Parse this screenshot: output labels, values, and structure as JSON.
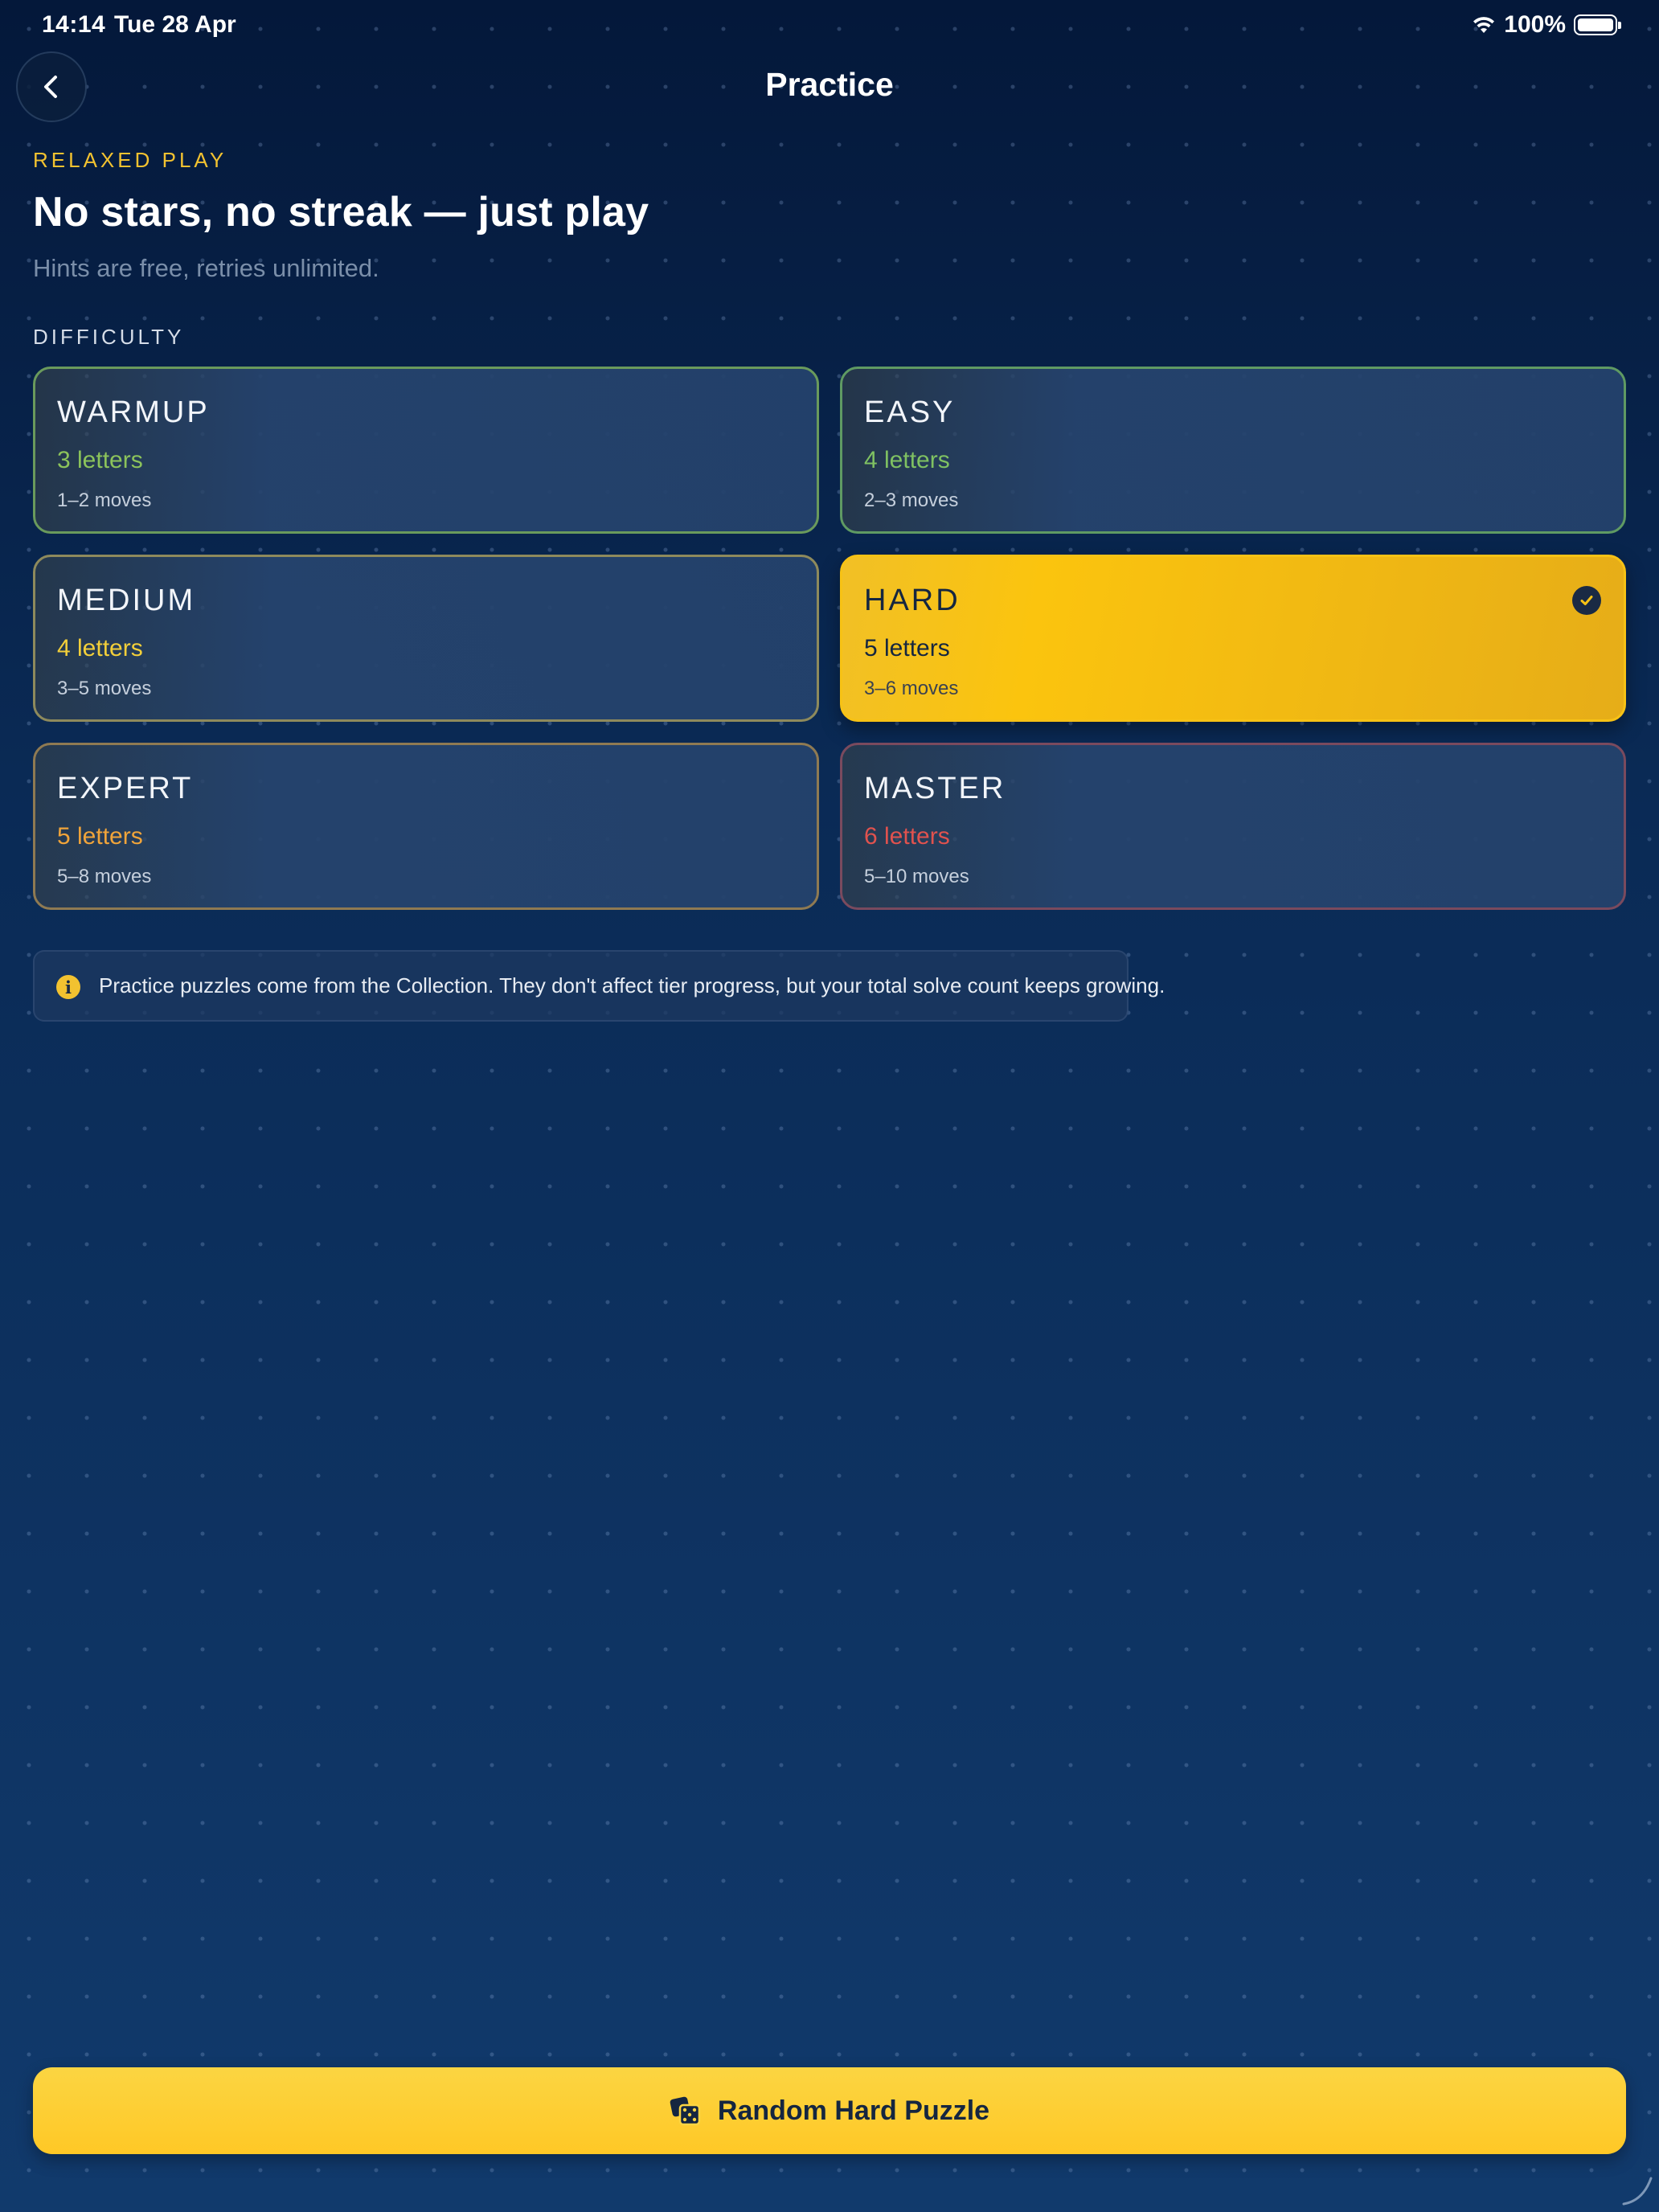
{
  "status_bar": {
    "time": "14:14",
    "date": "Tue 28 Apr",
    "battery": "100%",
    "icons": [
      "wifi-icon",
      "battery-icon"
    ]
  },
  "nav": {
    "title": "Practice",
    "back_icon": "chevron-left-icon"
  },
  "header": {
    "eyebrow": "RELAXED PLAY",
    "headline": "No stars, no streak — just play",
    "subtitle": "Hints are free, retries unlimited."
  },
  "section_label": "DIFFICULTY",
  "difficulties": [
    {
      "level": "WARMUP",
      "letters": "3 letters",
      "moves": "1–2 moves",
      "accent": "#6a9a5c",
      "letters_color": "#8cc35b",
      "selected": false
    },
    {
      "level": "EASY",
      "letters": "4 letters",
      "moves": "2–3 moves",
      "accent": "#5f9a63",
      "letters_color": "#7fc162",
      "selected": false
    },
    {
      "level": "MEDIUM",
      "letters": "4 letters",
      "moves": "3–5 moves",
      "accent": "#8e8a5c",
      "letters_color": "#f2cf3a",
      "selected": false
    },
    {
      "level": "HARD",
      "letters": "5 letters",
      "moves": "3–6 moves",
      "accent": "#f7c215",
      "letters_color": "#152640",
      "selected": true
    },
    {
      "level": "EXPERT",
      "letters": "5 letters",
      "moves": "5–8 moves",
      "accent": "#8f7a52",
      "letters_color": "#f0a43a",
      "selected": false
    },
    {
      "level": "MASTER",
      "letters": "6 letters",
      "moves": "5–10 moves",
      "accent": "#7a4a5e",
      "letters_color": "#e0524e",
      "selected": false
    }
  ],
  "info": {
    "icon": "info-icon",
    "text": "Practice puzzles come from the Collection. They don't affect tier progress, but your total solve count keeps growing."
  },
  "cta": {
    "label": "Random Hard Puzzle",
    "icon": "dice-icon"
  },
  "colors": {
    "background_top": "#04183a",
    "background_bottom": "#113a6c",
    "accent_yellow": "#f7c215",
    "eyebrow": "#f2c230"
  }
}
